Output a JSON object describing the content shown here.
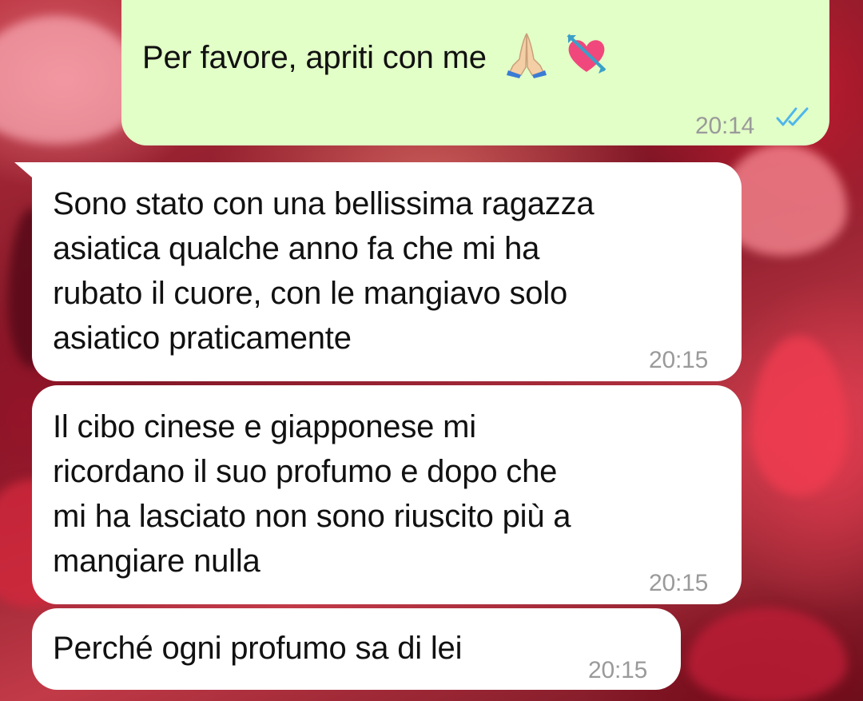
{
  "messages": [
    {
      "direction": "outgoing",
      "text": "Per favore, apriti con me",
      "emoji": [
        "folded-hands",
        "heart-with-arrow"
      ],
      "time": "20:14",
      "status": "read"
    },
    {
      "direction": "incoming",
      "lines": [
        "Sono stato con una bellissima ragazza",
        "asiatica qualche anno fa che mi ha",
        "rubato il cuore, con le mangiavo solo",
        "asiatico praticamente"
      ],
      "time": "20:15"
    },
    {
      "direction": "incoming",
      "lines": [
        "Il cibo cinese e giapponese mi",
        "ricordano il suo profumo e dopo che",
        "mi ha lasciato non sono riuscito più a",
        "mangiare nulla"
      ],
      "time": "20:15"
    },
    {
      "direction": "incoming",
      "text": "Perché ogni profumo sa di lei",
      "time": "20:15"
    }
  ],
  "colors": {
    "outgoing_bubble": "#e2ffc7",
    "incoming_bubble": "#ffffff",
    "read_ticks": "#4fb6ec",
    "timestamp": "#9a9a9a"
  }
}
